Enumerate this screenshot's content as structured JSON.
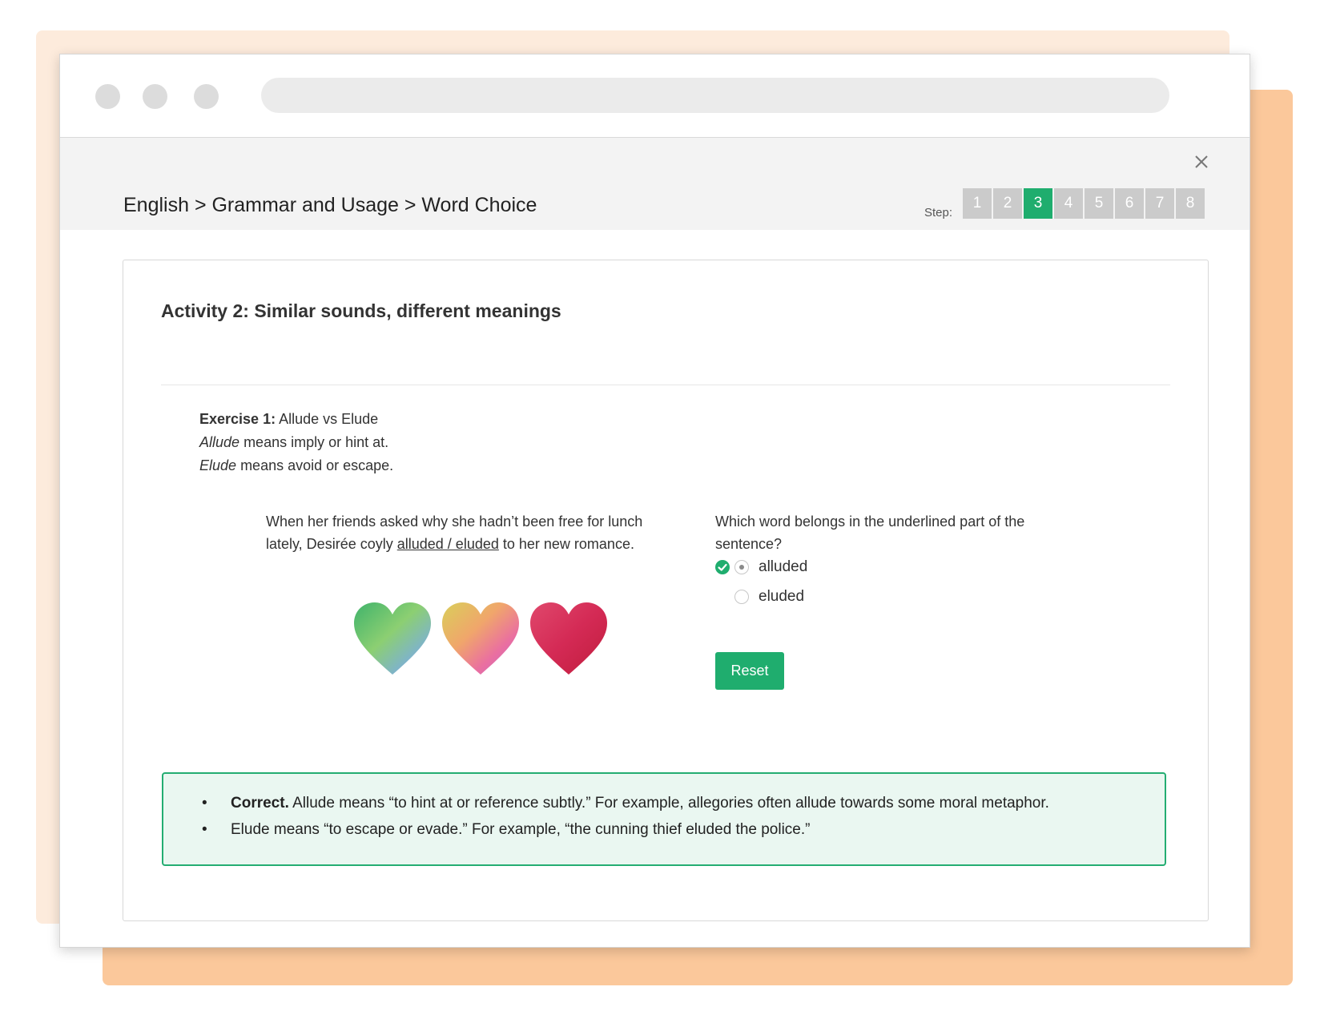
{
  "header": {
    "breadcrumb": "English > Grammar and Usage > Word Choice",
    "step_label": "Step:",
    "steps": [
      "1",
      "2",
      "3",
      "4",
      "5",
      "6",
      "7",
      "8"
    ],
    "active_step": "3"
  },
  "activity": {
    "title": "Activity 2: Similar sounds, different meanings"
  },
  "exercise": {
    "label": "Exercise 1:",
    "title": "Allude vs Elude",
    "line1_term": "Allude",
    "line1_rest": "means imply or hint at.",
    "line2_term": "Elude",
    "line2_rest": "means avoid or escape."
  },
  "sentence": {
    "before": "When her friends asked why she hadn’t been free for lunch lately, Desirée coyly",
    "underlined": "alluded / eluded",
    "after": "to her new romance."
  },
  "question": {
    "text": "Which word belongs in the underlined part of the sentence?",
    "options": [
      {
        "label": "alluded",
        "selected": true,
        "correct": true
      },
      {
        "label": "eluded",
        "selected": false,
        "correct": false
      }
    ],
    "reset_label": "Reset"
  },
  "feedback": {
    "bullet": "•",
    "line1_bold": "Correct.",
    "line1_rest": "Allude means “to hint at or reference subtly.” For example, allegories often allude towards some moral metaphor.",
    "line2": "Elude means “to escape or evade.” For example, “the cunning thief eluded the police.”"
  },
  "colors": {
    "accent": "#1fad6e",
    "step_inactive": "#cbcbcb",
    "feedback_bg": "#eaf7f1",
    "decor_peach": "#fbc89b"
  },
  "icons": {
    "close": "close-icon",
    "check": "check-circle-icon"
  }
}
